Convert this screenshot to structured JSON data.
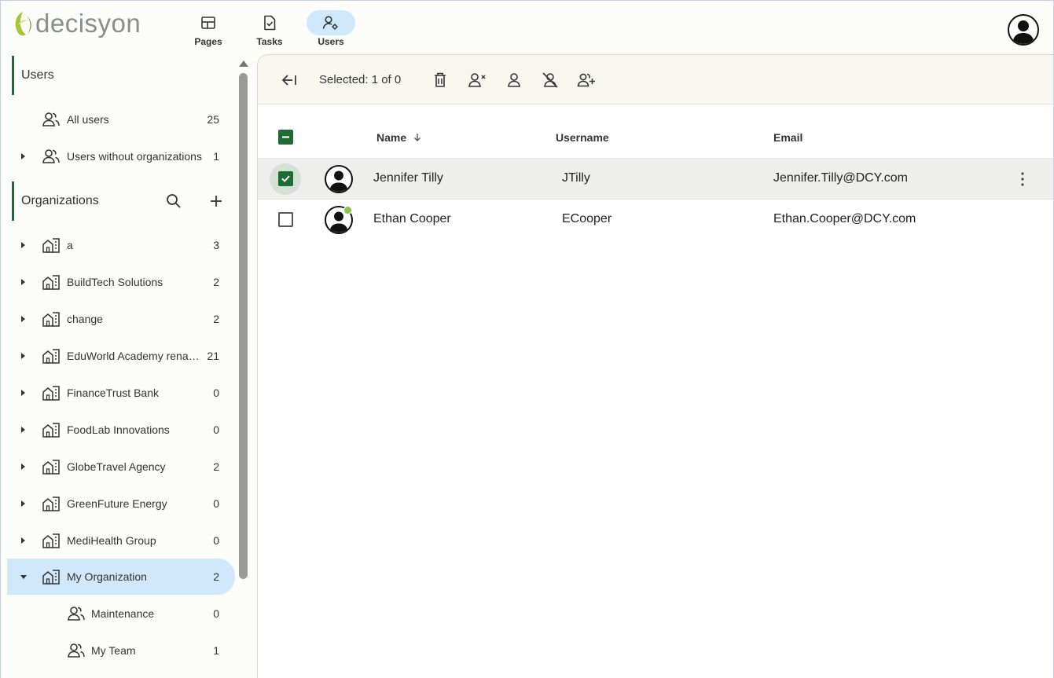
{
  "brand": {
    "name": "decisyon",
    "accent": "#1e6b34",
    "nav_active_bg": "#cfe8fb"
  },
  "nav": [
    {
      "label": "Pages",
      "icon": "pages-icon"
    },
    {
      "label": "Tasks",
      "icon": "tasks-icon"
    },
    {
      "label": "Users",
      "icon": "users-settings-icon",
      "active": true
    }
  ],
  "sidebar": {
    "users_title": "Users",
    "user_items": [
      {
        "label": "All users",
        "count": "25"
      },
      {
        "label": "Users without organizations",
        "count": "1"
      }
    ],
    "org_title": "Organizations",
    "orgs": [
      {
        "label": "a",
        "count": "3"
      },
      {
        "label": "BuildTech Solutions",
        "count": "2"
      },
      {
        "label": "change",
        "count": "2"
      },
      {
        "label": "EduWorld Academy renamed",
        "count": "21"
      },
      {
        "label": "FinanceTrust Bank",
        "count": "0"
      },
      {
        "label": "FoodLab Innovations",
        "count": "0"
      },
      {
        "label": "GlobeTravel Agency",
        "count": "2"
      },
      {
        "label": "GreenFuture Energy",
        "count": "0"
      },
      {
        "label": "MediHealth Group",
        "count": "0"
      },
      {
        "label": "My Organization",
        "count": "2",
        "selected": true,
        "expanded": true
      }
    ],
    "sub_teams": [
      {
        "label": "Maintenance",
        "count": "0"
      },
      {
        "label": "My Team",
        "count": "1"
      }
    ]
  },
  "toolbar": {
    "selected_text": "Selected: 1 of 0"
  },
  "table": {
    "columns": {
      "name": "Name",
      "username": "Username",
      "email": "Email"
    },
    "rows": [
      {
        "name": "Jennifer Tilly",
        "username": "JTilly",
        "email": "Jennifer.Tilly@DCY.com",
        "checked": true
      },
      {
        "name": "Ethan Cooper",
        "username": "ECooper",
        "email": "Ethan.Cooper@DCY.com",
        "checked": false,
        "online": true
      }
    ]
  }
}
